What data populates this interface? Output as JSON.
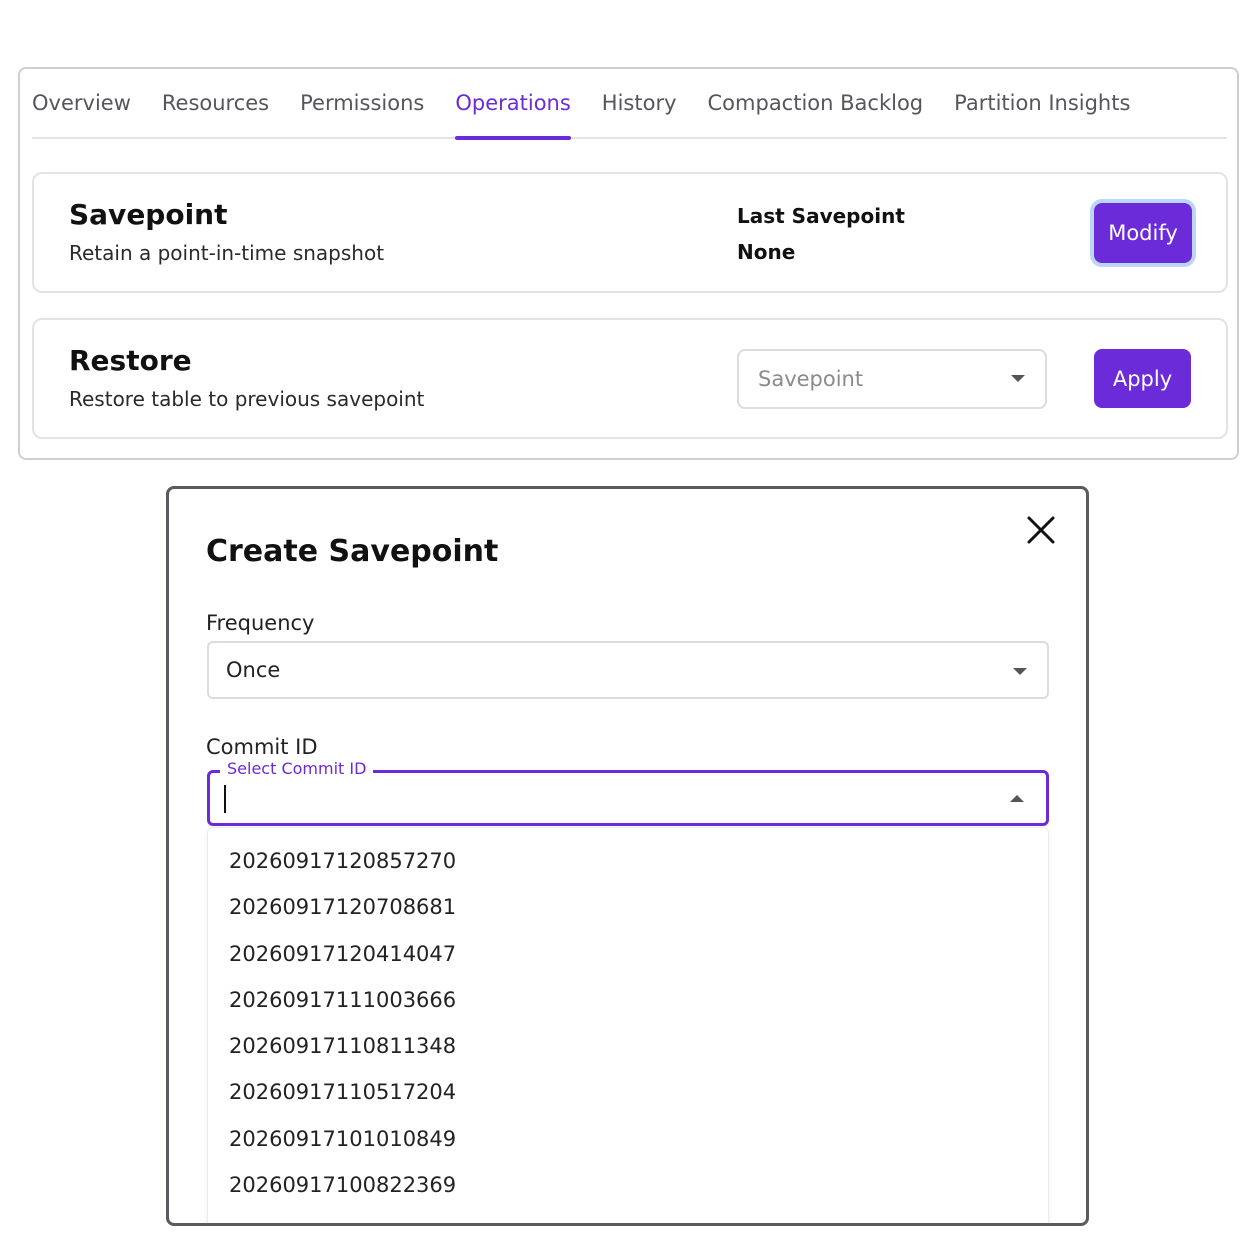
{
  "tabs": [
    {
      "label": "Overview",
      "active": false
    },
    {
      "label": "Resources",
      "active": false
    },
    {
      "label": "Permissions",
      "active": false
    },
    {
      "label": "Operations",
      "active": true
    },
    {
      "label": "History",
      "active": false
    },
    {
      "label": "Compaction Backlog",
      "active": false
    },
    {
      "label": "Partition Insights",
      "active": false
    }
  ],
  "savepoint": {
    "title": "Savepoint",
    "subtitle": "Retain a point-in-time snapshot",
    "last_label": "Last Savepoint",
    "last_value": "None",
    "modify_label": "Modify"
  },
  "restore": {
    "title": "Restore",
    "subtitle": "Restore table to previous savepoint",
    "select_placeholder": "Savepoint",
    "apply_label": "Apply"
  },
  "modal": {
    "title": "Create Savepoint",
    "frequency_label": "Frequency",
    "frequency_value": "Once",
    "commit_label": "Commit ID",
    "commit_field_legend": "Select Commit ID",
    "commit_value": "",
    "commit_options": [
      "20260917120857270",
      "20260917120708681",
      "20260917120414047",
      "20260917111003666",
      "20260917110811348",
      "20260917110517204",
      "20260917101010849",
      "20260917100822369"
    ]
  },
  "colors": {
    "accent": "#6c2bd9",
    "focus_ring": "#bcd6f7",
    "border": "#dcdce0"
  }
}
